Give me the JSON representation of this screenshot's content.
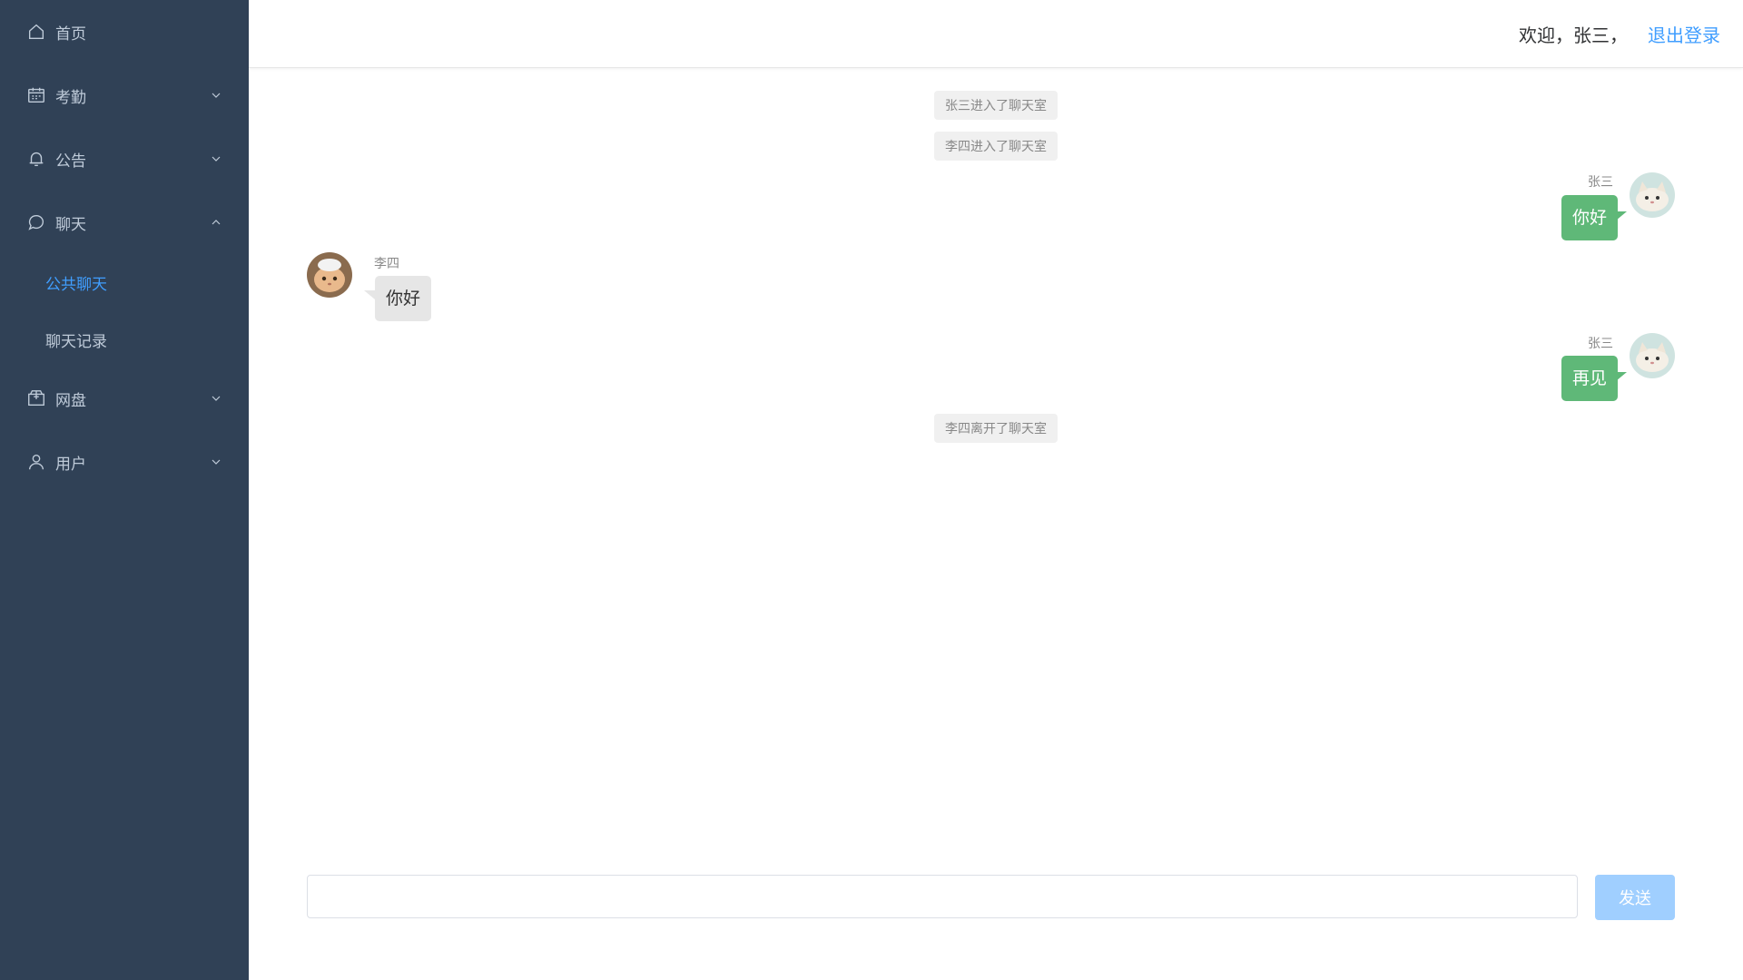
{
  "sidebar": {
    "items": [
      {
        "label": "首页",
        "icon": "home-icon"
      },
      {
        "label": "考勤",
        "icon": "calendar-icon"
      },
      {
        "label": "公告",
        "icon": "bell-icon"
      },
      {
        "label": "聊天",
        "icon": "chat-bubble-icon"
      },
      {
        "label": "网盘",
        "icon": "box-icon"
      },
      {
        "label": "用户",
        "icon": "user-icon"
      }
    ],
    "chat_submenu": [
      {
        "label": "公共聊天",
        "active": true
      },
      {
        "label": "聊天记录",
        "active": false
      }
    ]
  },
  "header": {
    "welcome": "欢迎，张三，",
    "logout": "退出登录"
  },
  "chat": {
    "system_messages": [
      "张三进入了聊天室",
      "李四进入了聊天室",
      "李四离开了聊天室"
    ],
    "messages": [
      {
        "sender": "张三",
        "text": "你好",
        "mine": true
      },
      {
        "sender": "李四",
        "text": "你好",
        "mine": false
      },
      {
        "sender": "张三",
        "text": "再见",
        "mine": true
      }
    ]
  },
  "composer": {
    "placeholder": "",
    "send_label": "发送"
  },
  "colors": {
    "sidebar_bg": "#304156",
    "accent": "#409eff",
    "mine_bubble": "#5fb878",
    "send_disabled": "#a0cfff"
  }
}
